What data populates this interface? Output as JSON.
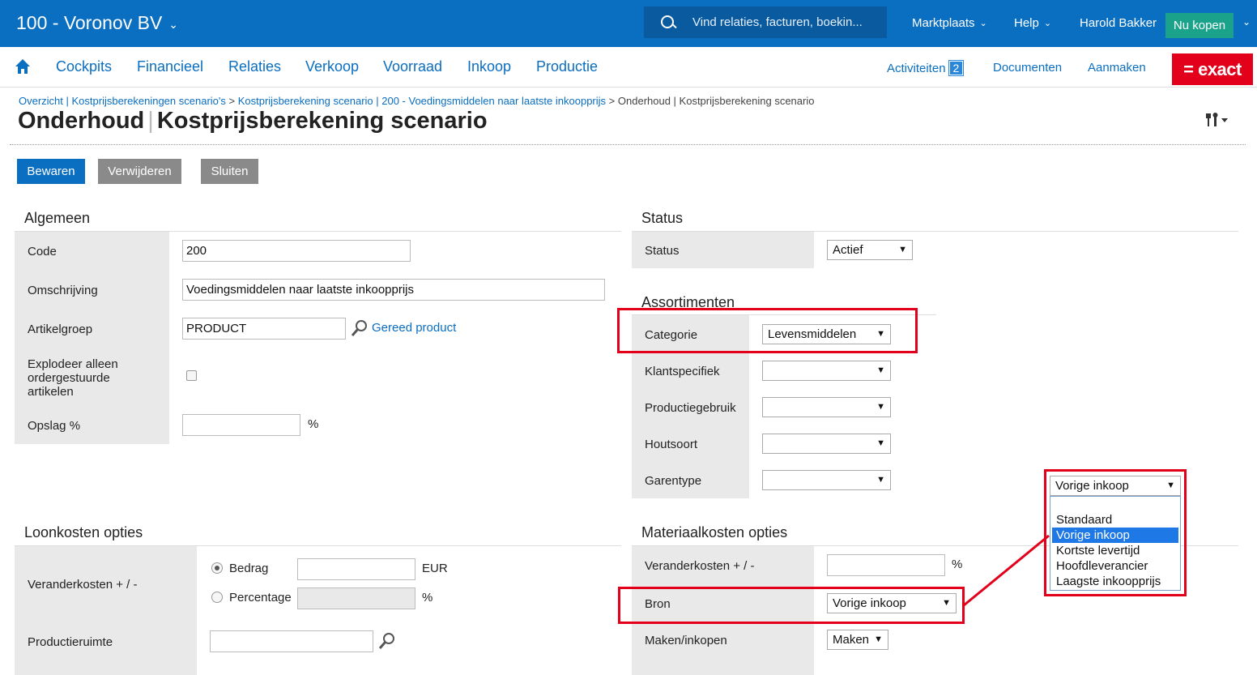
{
  "topbar": {
    "company": "100 - Voronov BV",
    "search_placeholder": "Vind relaties, facturen, boekin...",
    "marketplace": "Marktplaats",
    "help": "Help",
    "user": "Harold Bakker",
    "buy": "Nu kopen"
  },
  "nav": {
    "items": [
      "Cockpits",
      "Financieel",
      "Relaties",
      "Verkoop",
      "Voorraad",
      "Inkoop",
      "Productie"
    ],
    "activities": "Activiteiten",
    "activities_count": "2",
    "documents": "Documenten",
    "create": "Aanmaken",
    "logo": "= exact"
  },
  "breadcrumb": {
    "link1": "Overzicht | Kostprijsberekeningen scenario's",
    "link2": "Kostprijsberekening scenario | 200 - Voedingsmiddelen naar laatste inkoopprijs",
    "current": "Onderhoud | Kostprijsberekening scenario",
    "separator": ">"
  },
  "page": {
    "title_part1": "Onderhoud",
    "title_part2": "Kostprijsberekening scenario",
    "title_separator": "|"
  },
  "actions": {
    "save": "Bewaren",
    "delete": "Verwijderen",
    "close": "Sluiten"
  },
  "general": {
    "title": "Algemeen",
    "code_label": "Code",
    "code_value": "200",
    "description_label": "Omschrijving",
    "description_value": "Voedingsmiddelen naar laatste inkoopprijs",
    "itemgroup_label": "Artikelgroep",
    "itemgroup_value": "PRODUCT",
    "itemgroup_link": "Gereed product",
    "explode_label": "Explodeer alleen ordergestuurde artikelen",
    "markup_label": "Opslag %",
    "markup_unit": "%"
  },
  "status": {
    "title": "Status",
    "status_label": "Status",
    "status_value": "Actief"
  },
  "assortments": {
    "title": "Assortimenten",
    "category_label": "Categorie",
    "category_value": "Levensmiddelen",
    "customer_label": "Klantspecifiek",
    "usage_label": "Productiegebruik",
    "wood_label": "Houtsoort",
    "yarn_label": "Garentype"
  },
  "labor": {
    "title": "Loonkosten opties",
    "change_label": "Veranderkosten + / -",
    "amount_label": "Bedrag",
    "amount_unit": "EUR",
    "percentage_label": "Percentage",
    "percentage_unit": "%",
    "space_label": "Productieruimte"
  },
  "material": {
    "title": "Materiaalkosten opties",
    "change_label": "Veranderkosten + / -",
    "change_unit": "%",
    "source_label": "Bron",
    "source_value": "Vorige inkoop",
    "make_label": "Maken/inkopen",
    "make_value": "Maken"
  },
  "popup": {
    "selected": "Vorige inkoop",
    "options": [
      "Standaard",
      "Vorige inkoop",
      "Kortste levertijd",
      "Hoofdleverancier",
      "Laagste inkoopprijs"
    ]
  },
  "colors": {
    "brand_blue": "#0a6ec1",
    "highlight_red": "#e3001b",
    "buy_green": "#1aa38a"
  },
  "icons": {
    "search": "magnifier-icon",
    "home": "home-icon",
    "tools": "tools-icon"
  }
}
